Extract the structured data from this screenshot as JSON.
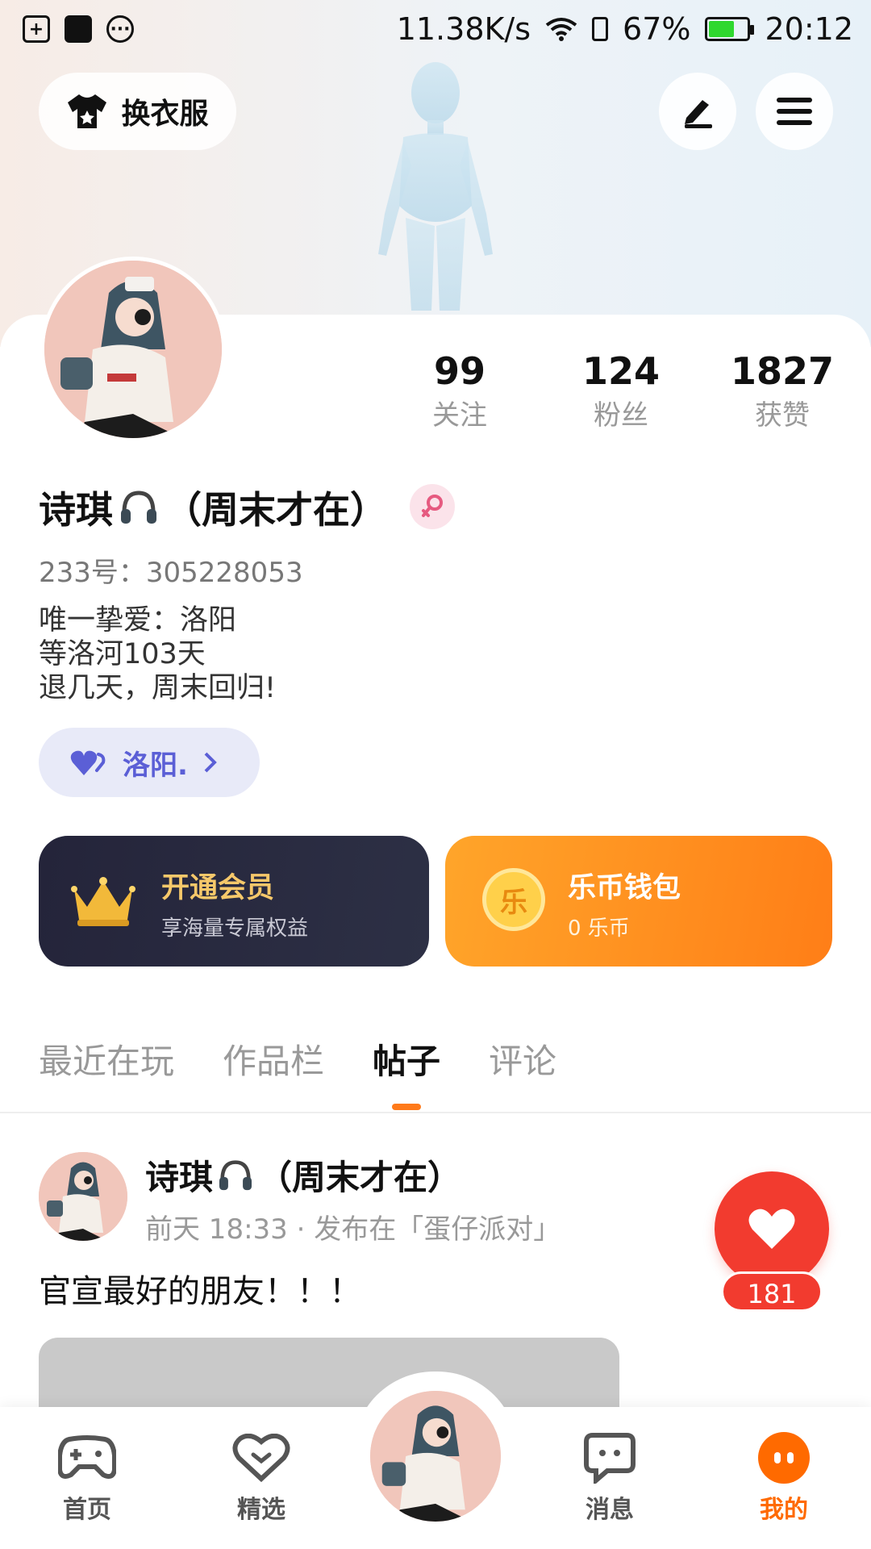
{
  "status_bar": {
    "network_speed": "11.38K/s",
    "battery_percent": "67%",
    "time": "20:12",
    "battery_level": 0.67,
    "icons": [
      "sim-add-icon",
      "image-icon",
      "more-dots-icon",
      "wifi-icon",
      "sim-card-icon",
      "battery-icon"
    ]
  },
  "header": {
    "dress_button_label": "换衣服"
  },
  "stats": [
    {
      "value": "99",
      "label": "关注"
    },
    {
      "value": "124",
      "label": "粉丝"
    },
    {
      "value": "1827",
      "label": "获赞"
    }
  ],
  "profile": {
    "nickname_prefix": "诗琪",
    "nickname_suffix": "（周末才在）",
    "uid": "233号：305228053",
    "bio_lines": [
      "唯一挚爱：洛阳",
      "等洛河103天",
      "退几天，周末回归!"
    ],
    "partner_name": "洛阳."
  },
  "vip": {
    "title": "开通会员",
    "subtitle": "享海量专属权益"
  },
  "wallet": {
    "title": "乐币钱包",
    "subtitle": "0 乐币",
    "coin_char": "乐"
  },
  "tabs": [
    {
      "label": "最近在玩",
      "active": false
    },
    {
      "label": "作品栏",
      "active": false
    },
    {
      "label": "帖子",
      "active": true
    },
    {
      "label": "评论",
      "active": false
    }
  ],
  "post": {
    "author_prefix": "诗琪",
    "author_suffix": "（周末才在）",
    "meta": "前天 18:33 · 发布在「蛋仔派对」",
    "text": "官宣最好的朋友！！！",
    "like_count": "181"
  },
  "bottom_nav": [
    {
      "label": "首页",
      "icon": "gamepad-icon"
    },
    {
      "label": "精选",
      "icon": "heart-chat-icon"
    },
    {
      "label": "消息",
      "icon": "message-icon"
    },
    {
      "label": "我的",
      "icon": "profile-face-icon",
      "active": true
    }
  ],
  "colors": {
    "accent": "#ff6a00",
    "like": "#f23b2f",
    "partner": "#5b5fd6",
    "battery": "#2fd82f"
  }
}
